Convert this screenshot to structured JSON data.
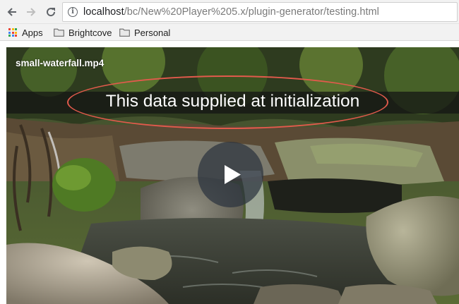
{
  "toolbar": {
    "back_icon": "arrow-left-icon",
    "forward_icon": "arrow-right-icon",
    "reload_icon": "reload-icon",
    "site_info_icon": "info-icon",
    "site_info_glyph": "i",
    "url_host": "localhost",
    "url_path": "/bc/New%20Player%205.x/plugin-generator/testing.html"
  },
  "bookmarks": {
    "items": [
      {
        "label": "Apps",
        "icon": "apps-grid-icon"
      },
      {
        "label": "Brightcove",
        "icon": "folder-icon"
      },
      {
        "label": "Personal",
        "icon": "folder-icon"
      }
    ]
  },
  "player": {
    "title": "small-waterfall.mp4",
    "overlay_text": "This data supplied at initialization",
    "annotation_color": "#e25a4c",
    "play_icon": "play-icon"
  },
  "colors": {
    "chrome_bg": "#f2f2f2",
    "overlay_band": "#141414",
    "apps_grid": [
      "#ea4335",
      "#fbbc05",
      "#34a853",
      "#4285f4",
      "#ea4335",
      "#fbbc05",
      "#34a853",
      "#4285f4",
      "#ea4335"
    ]
  }
}
